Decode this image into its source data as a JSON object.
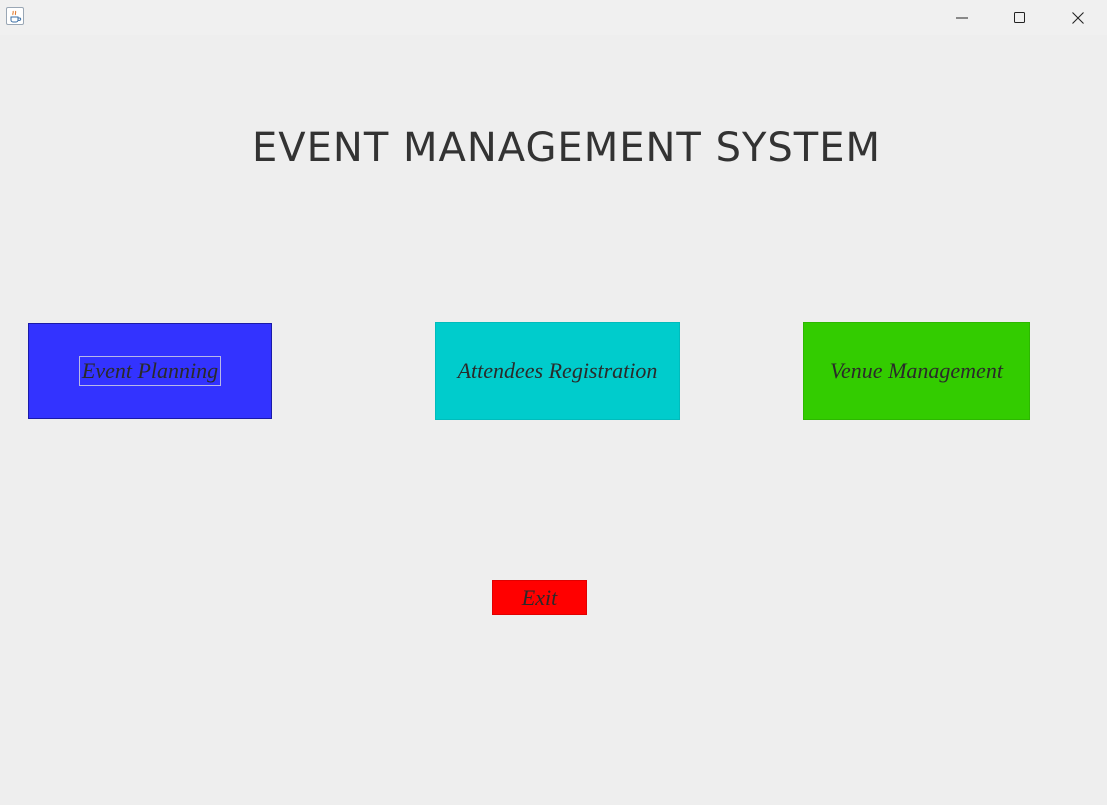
{
  "window": {
    "title": ""
  },
  "title": "EVENT MANAGEMENT SYSTEM",
  "buttons": {
    "event_planning": "Event Planning",
    "attendees_registration": "Attendees Registration",
    "venue_management": "Venue Management",
    "exit": "Exit"
  },
  "colors": {
    "event_planning": "#3333ff",
    "attendees_registration": "#00cccc",
    "venue_management": "#33cc00",
    "exit": "#ff0000",
    "background": "#eeeeee"
  },
  "icons": {
    "app": "java-cup-icon",
    "minimize": "minimize-icon",
    "maximize": "maximize-icon",
    "close": "close-icon"
  }
}
